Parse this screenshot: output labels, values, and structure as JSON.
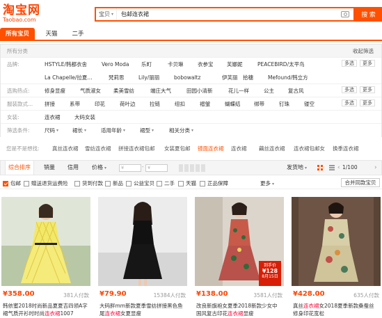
{
  "logo": {
    "main": "淘宝网",
    "sub": "Taobao.com"
  },
  "search": {
    "scope": "宝贝",
    "query": "包邮连衣裙",
    "button": "搜 索"
  },
  "tabs": [
    "所有宝贝",
    "天猫",
    "二手"
  ],
  "filters": {
    "all_label": "所有分类",
    "collapse": "收起筛选",
    "brand_label": "品牌:",
    "brands_row1": [
      "HSTYLE/韩都衣舍",
      "Vero Moda",
      "乐町",
      "卡贝琳",
      "衣参宝",
      "芙娜妮",
      "PEACEBIRD/太平鸟"
    ],
    "brands_row2": [
      "La Chapelle/拉夏...",
      "梵莉思",
      "Lily/丽丽",
      "bobowaltz",
      "伊芙丽",
      "拾穗",
      "Mefound/韩立方"
    ],
    "multi": "多选",
    "more": "更多",
    "hot_label": "选购热点:",
    "hot": [
      "修身显瘦",
      "气质淑女",
      "柔美雪纺",
      "端庄大气",
      "田园小清新",
      "花儿一样",
      "公主",
      "复古风"
    ],
    "detail_label": "服装款式...",
    "detail": [
      "拼接",
      "系带",
      "印花",
      "荷叶边",
      "拉链",
      "纽扣",
      "褶皱",
      "蝴蝶结",
      "绑带",
      "钉珠",
      "镂空"
    ],
    "women_label": "女装:",
    "women": [
      "连衣裙",
      "大码女装"
    ],
    "cond_label": "筛选条件:",
    "cond": [
      "尺码",
      "裙长",
      "适用年龄",
      "裙型",
      "相关分类"
    ]
  },
  "related": {
    "label": "您是不是想找:",
    "terms": [
      "真丝连衣裙",
      "雪纺连衣裙",
      "拼接连衣裙包邮",
      "女装夏包邮",
      "镜面连衣裙",
      "连衣裙",
      "藕丝连衣裙",
      "连衣裙包邮女",
      "麻连衣裙",
      "换季连衣裙"
    ],
    "highlight_index": 4
  },
  "sort": {
    "items": [
      "综合排序",
      "销量",
      "信用",
      "价格"
    ],
    "price_placeholder": "¥",
    "ship": "发货地",
    "page": "1/100"
  },
  "options": {
    "items": [
      "包邮",
      "赠送退货运费险",
      "货到付款",
      "新品",
      "公益宝贝",
      "二手",
      "天猫",
      "正品保障"
    ],
    "checked": [
      true,
      false,
      false,
      false,
      false,
      false,
      false,
      false
    ],
    "more": "更多",
    "merge": "合并同款宝贝"
  },
  "products": [
    {
      "price": "¥358.00",
      "paid": "381人付款",
      "title_pre": "韩依蜜2018时尚新品夏夏吉四领A字裙气质开衫时时尚",
      "title_hl": "连衣裙",
      "title_post": "1007"
    },
    {
      "price": "¥79.90",
      "paid": "15384人付款",
      "title_pre": "大码胖mm新款夏季雪纺拼接黑色鱼尾",
      "title_hl": "连衣裙",
      "title_post": "女夏显瘦"
    },
    {
      "price": "¥138.00",
      "paid": "3581人付款",
      "title_pre": "改良新旗袍女夏季2018新款少女中国风复古印花",
      "title_hl": "连衣裙",
      "title_post": "显瘦",
      "badge_top": "到手价",
      "badge_price": "¥128",
      "badge_note": "8月15日"
    },
    {
      "price": "¥428.00",
      "paid": "635人付款",
      "title_pre": "真丝",
      "title_hl": "连衣裙",
      "title_post": "女2018夏季新款桑蚕丝修身印花宽松"
    }
  ]
}
